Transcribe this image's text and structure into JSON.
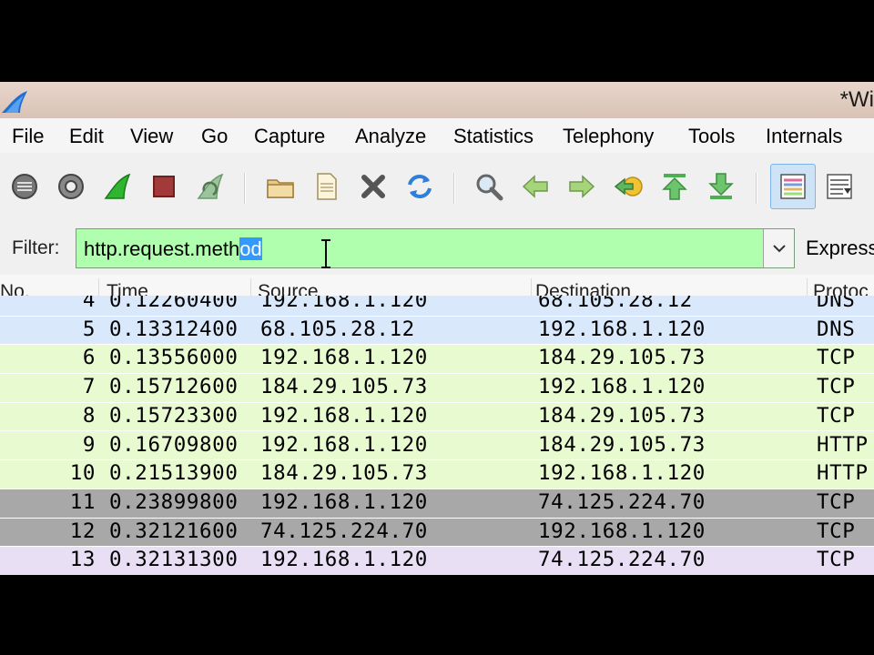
{
  "window": {
    "title": "*Wi"
  },
  "menu": [
    "File",
    "Edit",
    "View",
    "Go",
    "Capture",
    "Analyze",
    "Statistics",
    "Telephony",
    "Tools",
    "Internals"
  ],
  "toolbar": {
    "buttons": [
      "interfaces-icon",
      "capture-options-icon",
      "start-capture-icon",
      "stop-capture-icon",
      "restart-capture-icon",
      "open-file-icon",
      "save-file-icon",
      "close-file-icon",
      "reload-icon",
      "find-packet-icon",
      "go-back-icon",
      "go-forward-icon",
      "go-to-packet-icon",
      "go-first-packet-icon",
      "go-last-packet-icon",
      "colorize-icon",
      "auto-scroll-icon"
    ]
  },
  "filter": {
    "label": "Filter:",
    "value_plain": "http.request.meth",
    "value_selected": "od",
    "expression_label": "Express"
  },
  "columns": [
    "No.",
    "Time",
    "Source",
    "Destination",
    "Protoc"
  ],
  "packets": [
    {
      "no": "4",
      "time": "0.12260400",
      "source": "192.168.1.120",
      "destination": "68.105.28.12",
      "protocol": "DNS",
      "color": "#dae8fc"
    },
    {
      "no": "5",
      "time": "0.13312400",
      "source": "68.105.28.12",
      "destination": "192.168.1.120",
      "protocol": "DNS",
      "color": "#dae8fc"
    },
    {
      "no": "6",
      "time": "0.13556000",
      "source": "192.168.1.120",
      "destination": "184.29.105.73",
      "protocol": "TCP",
      "color": "#e8fad0"
    },
    {
      "no": "7",
      "time": "0.15712600",
      "source": "184.29.105.73",
      "destination": "192.168.1.120",
      "protocol": "TCP",
      "color": "#e8fad0"
    },
    {
      "no": "8",
      "time": "0.15723300",
      "source": "192.168.1.120",
      "destination": "184.29.105.73",
      "protocol": "TCP",
      "color": "#e8fad0"
    },
    {
      "no": "9",
      "time": "0.16709800",
      "source": "192.168.1.120",
      "destination": "184.29.105.73",
      "protocol": "HTTP",
      "color": "#e8fad0"
    },
    {
      "no": "10",
      "time": "0.21513900",
      "source": "184.29.105.73",
      "destination": "192.168.1.120",
      "protocol": "HTTP",
      "color": "#e8fad0"
    },
    {
      "no": "11",
      "time": "0.23899800",
      "source": "192.168.1.120",
      "destination": "74.125.224.70",
      "protocol": "TCP",
      "color": "#a8a8a8"
    },
    {
      "no": "12",
      "time": "0.32121600",
      "source": "74.125.224.70",
      "destination": "192.168.1.120",
      "protocol": "TCP",
      "color": "#a8a8a8"
    },
    {
      "no": "13",
      "time": "0.32131300",
      "source": "192.168.1.120",
      "destination": "74.125.224.70",
      "protocol": "TCP",
      "color": "#e8dff5"
    }
  ]
}
